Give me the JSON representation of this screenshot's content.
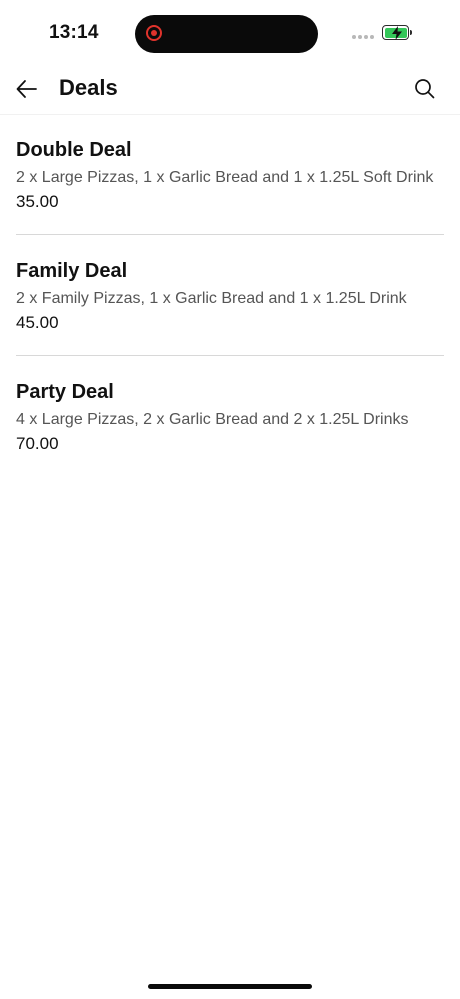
{
  "status_bar": {
    "time": "13:14"
  },
  "header": {
    "title": "Deals",
    "back_icon": "arrow-left-icon",
    "search_icon": "search-icon"
  },
  "deals": [
    {
      "name": "Double Deal",
      "description": "2 x Large Pizzas, 1 x Garlic Bread and 1 x 1.25L Soft Drink",
      "price": "35.00"
    },
    {
      "name": "Family Deal",
      "description": "2 x Family Pizzas, 1 x Garlic Bread and 1 x 1.25L Drink",
      "price": "45.00"
    },
    {
      "name": "Party Deal",
      "description": "4 x Large Pizzas, 2 x Garlic Bread and 2 x 1.25L Drinks",
      "price": "70.00"
    }
  ],
  "colors": {
    "recording": "#e0332c",
    "battery_charging": "#34c759",
    "divider": "#d8d8d8",
    "secondary_text": "#555555"
  }
}
